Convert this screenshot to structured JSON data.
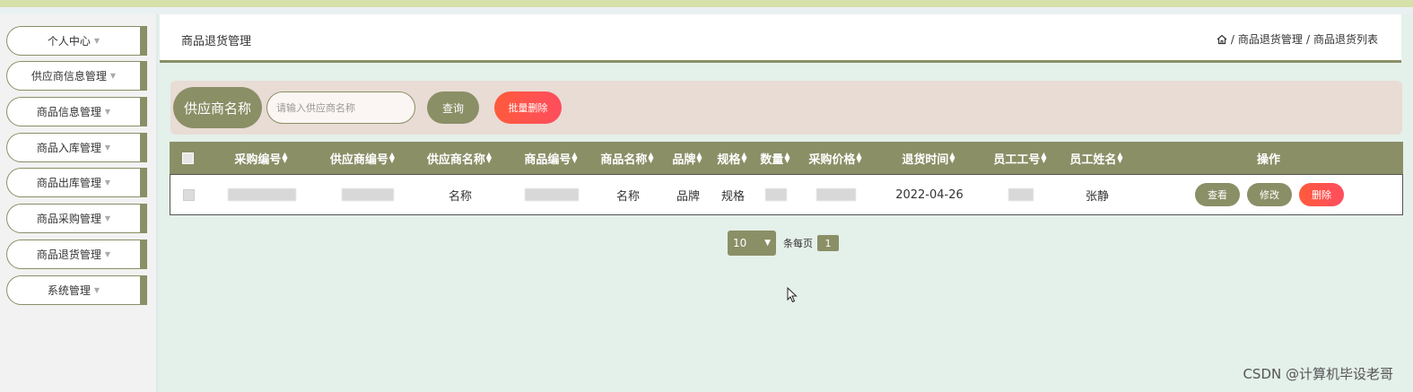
{
  "sidebar": {
    "items": [
      {
        "label": "个人中心"
      },
      {
        "label": "供应商信息管理"
      },
      {
        "label": "商品信息管理"
      },
      {
        "label": "商品入库管理"
      },
      {
        "label": "商品出库管理"
      },
      {
        "label": "商品采购管理"
      },
      {
        "label": "商品退货管理"
      },
      {
        "label": "系统管理"
      }
    ]
  },
  "header": {
    "title": "商品退货管理",
    "breadcrumb": [
      "商品退货管理",
      "商品退货列表"
    ]
  },
  "search": {
    "label": "供应商名称",
    "placeholder": "请输入供应商名称",
    "query_label": "查询",
    "batch_delete_label": "批量删除"
  },
  "table": {
    "columns": [
      "采购编号",
      "供应商编号",
      "供应商名称",
      "商品编号",
      "商品名称",
      "品牌",
      "规格",
      "数量",
      "采购价格",
      "退货时间",
      "员工工号",
      "员工姓名",
      "操作"
    ],
    "rows": [
      {
        "supplier_name": "名称",
        "product_name": "名称",
        "brand": "品牌",
        "spec": "规格",
        "return_time": "2022-04-26",
        "staff_name": "张静"
      }
    ],
    "actions": {
      "view": "查看",
      "edit": "修改",
      "delete": "删除"
    }
  },
  "pager": {
    "page_size": "10",
    "per_page_text": "条每页",
    "current_page": "1"
  },
  "watermark": "CSDN @计算机毕设老哥",
  "colors": {
    "accent": "#8a8f66",
    "danger": "#ff5a3c",
    "background": "#e4f0ea"
  }
}
